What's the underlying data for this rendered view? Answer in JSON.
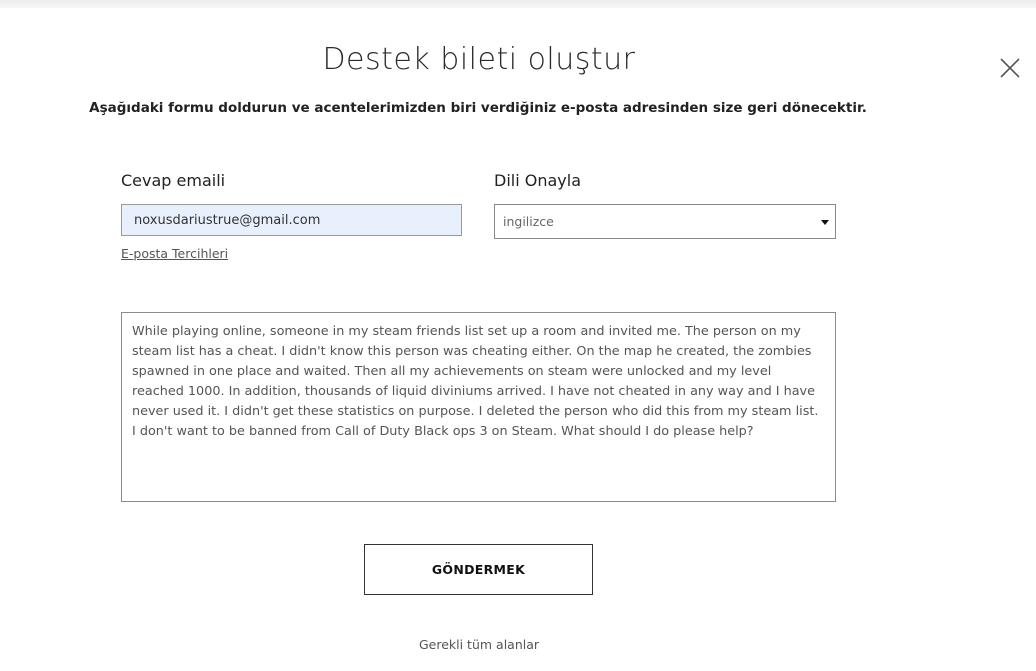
{
  "modal": {
    "title": "Destek bileti oluştur",
    "subtitle": "Aşağıdaki formu doldurun ve acentelerimizden biri verdiğiniz e-posta adresinden size geri dönecektir."
  },
  "form": {
    "email_label": "Cevap emaili",
    "email_value": "noxusdariustrue@gmail.com",
    "email_preferences_link": "E-posta Tercihleri",
    "language_label": "Dili Onayla",
    "language_selected": "ingilizce",
    "message": "While playing online, someone in my steam friends list set up a room and invited me. The person on my steam list has a cheat. I didn't know this person was cheating either. On the map he created, the zombies spawned in one place and waited. Then all my achievements on steam were unlocked and my level reached 1000. In addition, thousands of liquid diviniums arrived. I have not cheated in any way and I have never used it. I didn't get these statistics on purpose. I deleted the person who did this from my steam list. I don't want to be banned from Call of Duty Black ops 3 on Steam. What should I do please help?",
    "submit_label": "GÖNDERMEK",
    "required_note": "Gerekli tüm alanlar"
  },
  "icons": {
    "close": "close-icon",
    "dropdown": "caret-down-icon"
  }
}
